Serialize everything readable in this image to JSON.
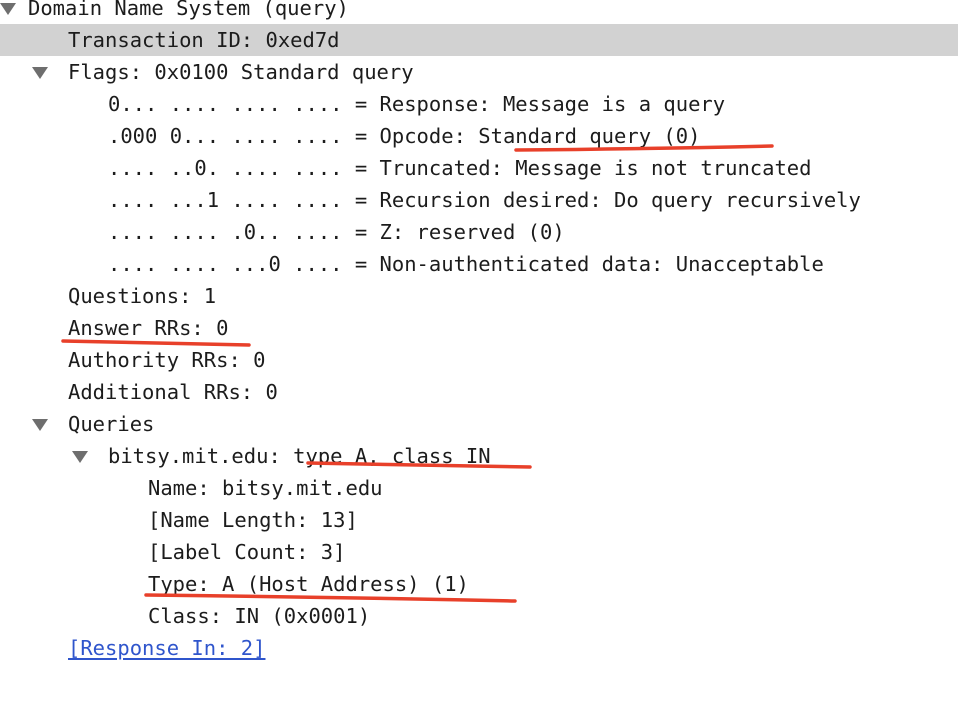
{
  "tree": {
    "rows": [
      {
        "text": "Domain Name System (query)"
      },
      {
        "text": "Transaction ID: 0xed7d"
      },
      {
        "text": "Flags: 0x0100 Standard query"
      },
      {
        "text": "0... .... .... .... = Response: Message is a query"
      },
      {
        "text": ".000 0... .... .... = Opcode: Standard query (0)"
      },
      {
        "text": ".... ..0. .... .... = Truncated: Message is not truncated"
      },
      {
        "text": ".... ...1 .... .... = Recursion desired: Do query recursively"
      },
      {
        "text": ".... .... .0.. .... = Z: reserved (0)"
      },
      {
        "text": ".... .... ...0 .... = Non-authenticated data: Unacceptable"
      },
      {
        "text": "Questions: 1"
      },
      {
        "text": "Answer RRs: 0"
      },
      {
        "text": "Authority RRs: 0"
      },
      {
        "text": "Additional RRs: 0"
      },
      {
        "text": "Queries"
      },
      {
        "text": "bitsy.mit.edu: type A, class IN"
      },
      {
        "text": "Name: bitsy.mit.edu"
      },
      {
        "text": "[Name Length: 13]"
      },
      {
        "text": "[Label Count: 3]"
      },
      {
        "text": "Type: A (Host Address) (1)"
      },
      {
        "text": "Class: IN (0x0001)"
      },
      {
        "text": "[Response In: 2]"
      }
    ]
  },
  "colors": {
    "selected_row": "#d2d2d2",
    "annotation": "#e8402a",
    "link": "#2f55cc",
    "expander": "#6e6e6e"
  },
  "icons": {
    "expander": "disclosure-triangle-expanded-icon"
  }
}
